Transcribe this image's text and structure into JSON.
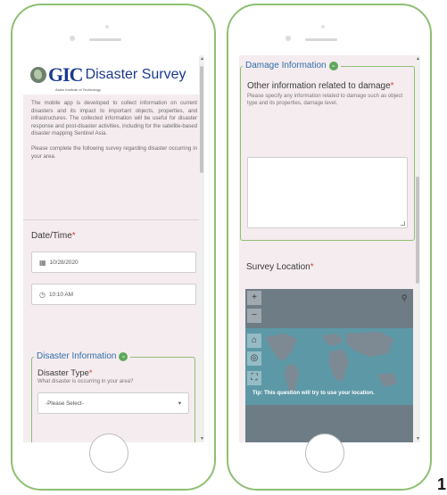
{
  "left_phone": {
    "logo": {
      "brand": "GIC",
      "title": "Disaster Survey",
      "subtitle": "Asian Institute of Technology"
    },
    "intro": {
      "paragraph_1": "The mobile app is developed to collect information on current disasters and its impact to important objects, properties, and infrastructures. The collected information will be useful for disaster response and post-disaster activities, including for the satellite-based disaster mapping Sentinel Asia.",
      "paragraph_2": "Please complete the following survey regarding disaster occurring in your area."
    },
    "datetime": {
      "label": "Date/Time",
      "required_mark": "*",
      "date_value": "10/28/2020",
      "time_value": "10:10 AM",
      "date_icon": "calendar-icon",
      "time_icon": "clock-icon"
    },
    "disaster_info": {
      "group_title": "Disaster Information",
      "toggle_icon": "chevron-down-icon",
      "type_label": "Disaster Type",
      "required_mark": "*",
      "type_hint": "What disaster is occurring in your area?",
      "select_value": "-Please Select-",
      "select_arrow": "▾"
    }
  },
  "right_phone": {
    "damage_info": {
      "group_title": "Damage Information",
      "toggle_icon": "chevron-down-icon",
      "question": "Other information related to damage",
      "required_mark": "*",
      "hint": "Please specify any information related to damage such as object type and its properties, damage level.",
      "textarea_value": ""
    },
    "survey_location": {
      "label": "Survey Location",
      "required_mark": "*",
      "tip": "Tip: This question will try to use your location.",
      "zoom_in": "+",
      "zoom_out": "−",
      "home_icon": "home-icon",
      "locate_icon": "locate-icon",
      "fullscreen_icon": "fullscreen-icon",
      "search_icon": "search-icon"
    }
  },
  "figure_number": "1",
  "colors": {
    "phone_border": "#8ebf73",
    "group_title": "#2f6fa8",
    "required": "#d8423e",
    "form_background": "#f5ecef",
    "logo": "#1a3a8c"
  }
}
